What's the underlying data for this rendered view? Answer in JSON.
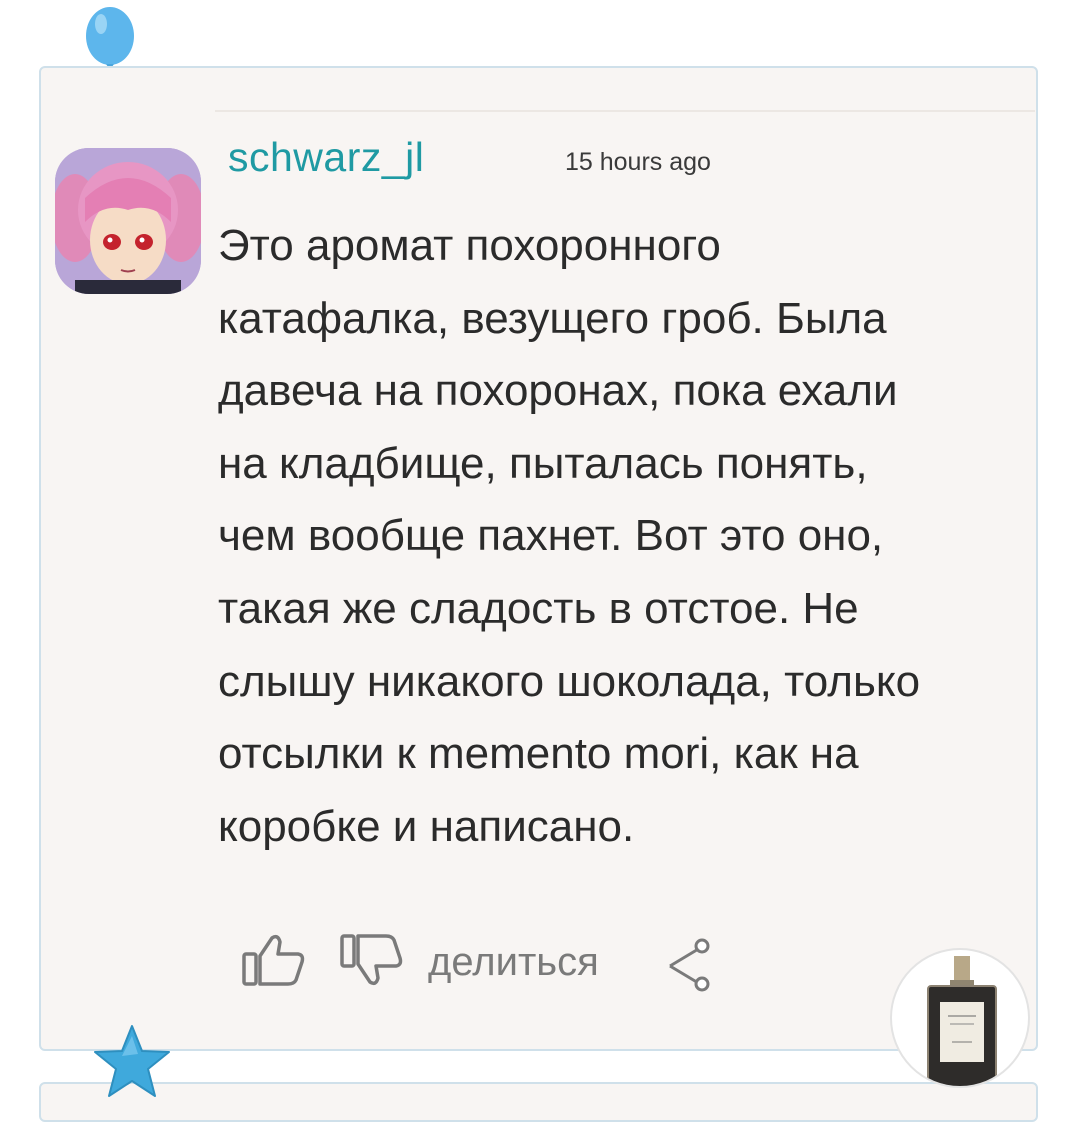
{
  "comment": {
    "username": "schwarz_jl",
    "timestamp": "15 hours ago",
    "text_lines": [
      "Это аромат похоронного",
      "катафалка, везущего гроб. Была",
      "давеча на похоронах, пока ехали",
      "на кладбище, пыталась понять,",
      "чем вообще пахнет. Вот это оно,",
      "такая же сладость в отстое. Не",
      "слышу никакого шоколада, только",
      "отсылки к memento mori, как на",
      "коробке и написано."
    ]
  },
  "actions": {
    "like_icon": "thumbs-up-icon",
    "dislike_icon": "thumbs-down-icon",
    "share_label": "делиться",
    "share_icon": "share-icon"
  },
  "decor": {
    "balloon_icon": "balloon-icon",
    "star_icon": "star-icon",
    "perfume_icon": "perfume-bottle-icon"
  },
  "colors": {
    "username": "#1f9aa3",
    "card_background": "#f8f5f3",
    "card_border": "#cfe0ea",
    "action_gray": "#7a7a7a"
  }
}
